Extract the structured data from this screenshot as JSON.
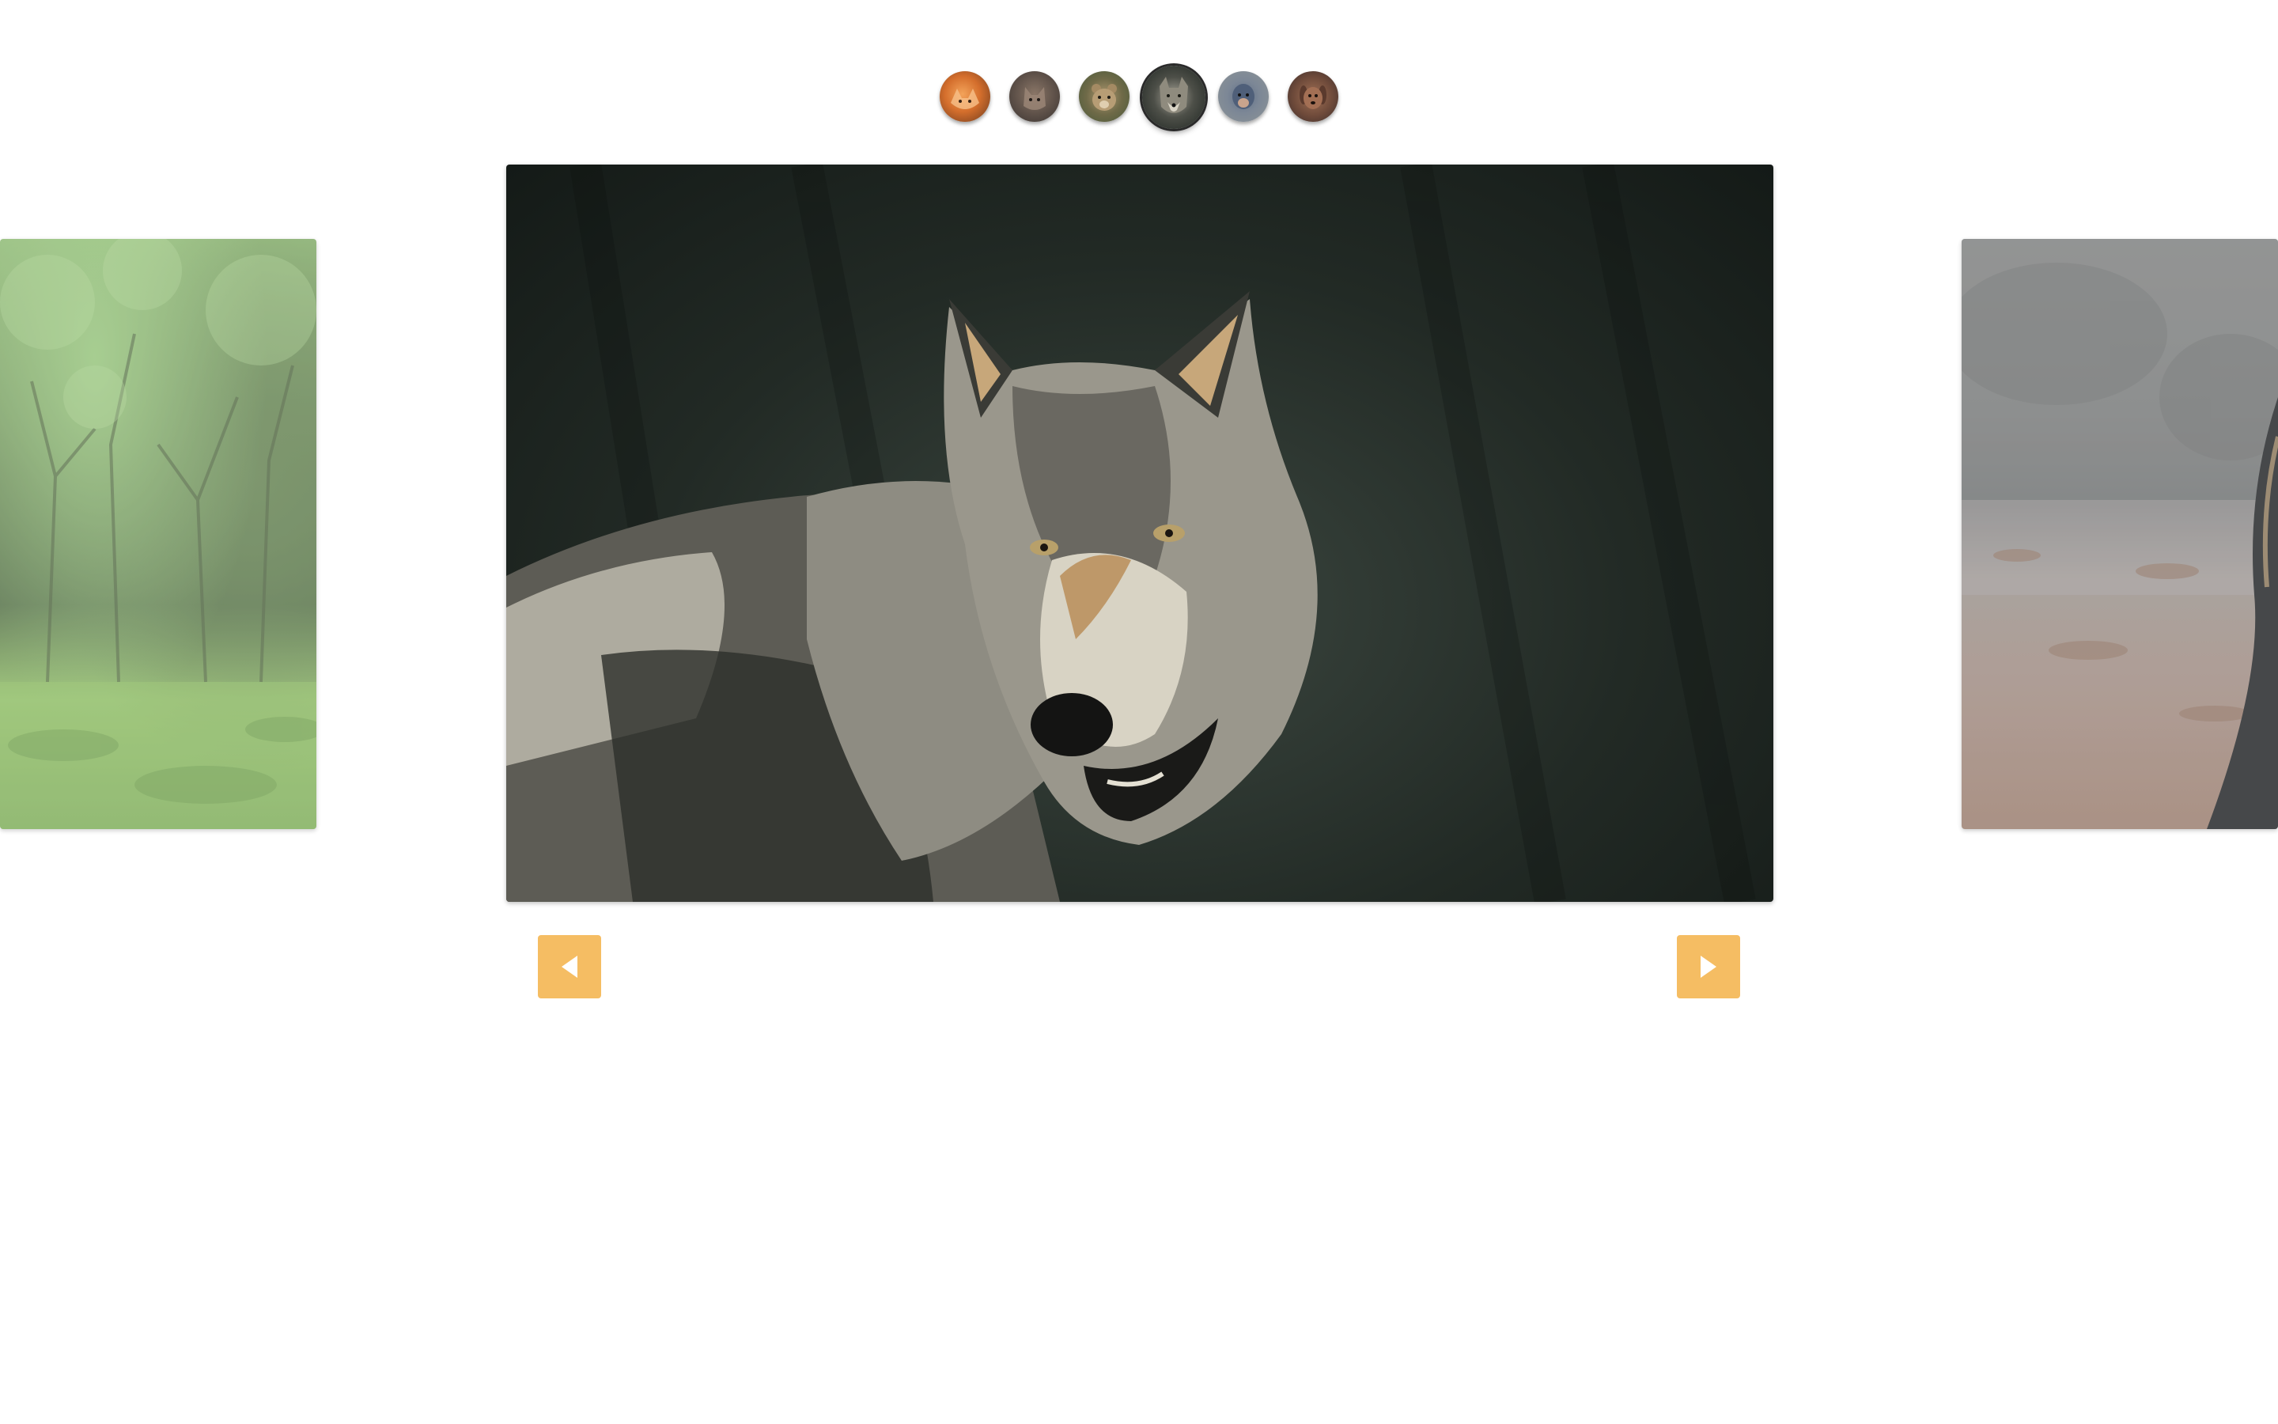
{
  "thumbnails": [
    {
      "name": "fox",
      "icon": "fox-thumbnail",
      "active": false
    },
    {
      "name": "cat",
      "icon": "cat-thumbnail",
      "active": false
    },
    {
      "name": "bear",
      "icon": "bear-thumbnail",
      "active": false
    },
    {
      "name": "wolf",
      "icon": "wolf-thumbnail",
      "active": true
    },
    {
      "name": "monkey",
      "icon": "monkey-thumbnail",
      "active": false
    },
    {
      "name": "dog",
      "icon": "dog-thumbnail",
      "active": false
    }
  ],
  "slides": {
    "previous": {
      "subject": "forest",
      "icon": "forest-image"
    },
    "current": {
      "subject": "wolf",
      "icon": "wolf-image"
    },
    "next": {
      "subject": "rocky-enclosure",
      "icon": "animal-image"
    }
  },
  "colors": {
    "nav_button": "#f5bd63",
    "nav_arrow": "#ffffff",
    "background": "#ffffff"
  },
  "controls": {
    "prev_icon": "triangle-left-icon",
    "next_icon": "triangle-right-icon"
  }
}
